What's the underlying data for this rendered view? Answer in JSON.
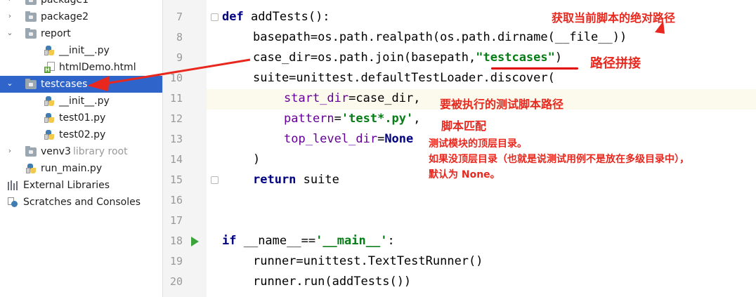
{
  "tree": {
    "items": [
      {
        "label": "package1",
        "icon": "folder-icon"
      },
      {
        "label": "package2",
        "icon": "folder-icon"
      },
      {
        "label": "report",
        "icon": "folder-icon",
        "expanded": true
      },
      {
        "label": "__init__.py",
        "icon": "python-file-icon"
      },
      {
        "label": "htmlDemo.html",
        "icon": "html-file-icon"
      },
      {
        "label": "testcases",
        "icon": "folder-icon",
        "expanded": true,
        "selected": true
      },
      {
        "label": "__init__.py",
        "icon": "python-file-icon"
      },
      {
        "label": "test01.py",
        "icon": "python-file-icon"
      },
      {
        "label": "test02.py",
        "icon": "python-file-icon"
      },
      {
        "label": "venv3",
        "icon": "folder-icon",
        "hint": "library root"
      },
      {
        "label": "run_main.py",
        "icon": "python-file-icon"
      },
      {
        "label": "External Libraries",
        "icon": "library-icon"
      },
      {
        "label": "Scratches and Consoles",
        "icon": "scratches-icon"
      }
    ]
  },
  "editor": {
    "line_numbers": [
      "7",
      "8",
      "9",
      "10",
      "11",
      "12",
      "13",
      "14",
      "15",
      "16",
      "17",
      "18",
      "19",
      "20"
    ],
    "current_line": "11"
  },
  "code": {
    "l7_kw": "def",
    "l7_rest": " addTests():",
    "l8": "basepath=os.path.realpath(os.path.dirname(__file__))",
    "l9_a": "case_dir=os.path.join(basepath,",
    "l9_str": "\"testcases\"",
    "l9_b": ")",
    "l10": "suite=unittest.defaultTestLoader.discover(",
    "l11_p": "start_dir",
    "l11_v": "=case_dir,",
    "l12_p": "pattern",
    "l12_eq": "=",
    "l12_str": "'test*.py'",
    "l12_c": ",",
    "l13_p": "top_level_dir",
    "l13_eq": "=",
    "l13_kw": "None",
    "l14": ")",
    "l15_kw": "return",
    "l15_rest": " suite",
    "l18_kw": "if",
    "l18_a": " __name__==",
    "l18_str": "'__main__'",
    "l18_b": ":",
    "l19": "runner=unittest.TextTestRunner()",
    "l20": "runner.run(addTests())"
  },
  "annotations": {
    "basepath": "获取当前脚本的绝对路径",
    "join": "路径拼接",
    "start_dir": "要被执行的测试脚本路径",
    "pattern": "脚本匹配",
    "top_level_1": "测试模块的顶层目录。",
    "top_level_2": "如果没顶层目录（也就是说测试用例不是放在多级目录中），",
    "top_level_3": "默认为 None。"
  },
  "colors": {
    "selection": "#2f65ca",
    "annotation": "#e8281e",
    "keyword": "#000080",
    "string": "#067d17",
    "param": "#660099",
    "current_line": "#fcfaed"
  }
}
